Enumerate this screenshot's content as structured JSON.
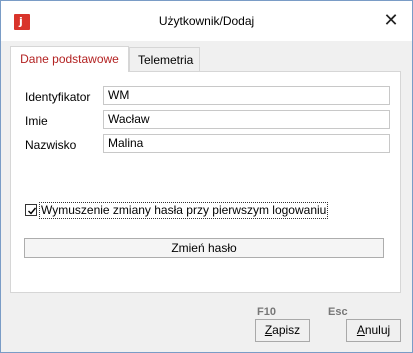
{
  "window": {
    "title": "Użytkownik/Dodaj",
    "app_icon_letter": "j",
    "close_glyph": "✕"
  },
  "tabs": [
    {
      "label": "Dane podstawowe",
      "active": true
    },
    {
      "label": "Telemetria",
      "active": false
    }
  ],
  "form": {
    "fields": [
      {
        "label": "Identyfikator",
        "value": "WM"
      },
      {
        "label": "Imie",
        "value": "Wacław"
      },
      {
        "label": "Nazwisko",
        "value": "Malina"
      }
    ],
    "force_password_change": {
      "label": "Wymuszenie zmiany hasła przy pierwszym logowaniu",
      "checked": true
    },
    "change_password_label": "Zmień hasło"
  },
  "footer": {
    "save": {
      "shortcut": "F10",
      "label_first": "Z",
      "label_rest": "apisz"
    },
    "cancel": {
      "shortcut": "Esc",
      "label_first": "A",
      "label_rest": "nuluj"
    }
  },
  "colors": {
    "accent": "#b32222",
    "app_icon": "#d9342b",
    "border": "#7a9cc6"
  }
}
